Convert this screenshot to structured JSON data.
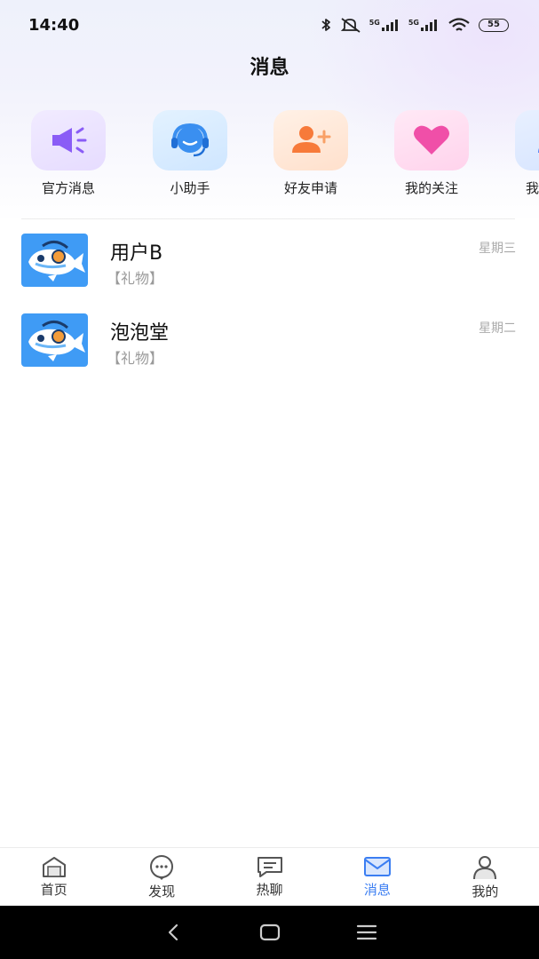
{
  "status_bar": {
    "time": "14:40",
    "network_1": "5G",
    "network_2": "5G",
    "battery": "55"
  },
  "header": {
    "title": "消息"
  },
  "quick_entries": [
    {
      "label": "官方消息",
      "icon": "megaphone-icon",
      "color": "#8a5cf6"
    },
    {
      "label": "小助手",
      "icon": "headset-icon",
      "color": "#3a8ff0"
    },
    {
      "label": "好友申请",
      "icon": "add-friend-icon",
      "color": "#f77a3a"
    },
    {
      "label": "我的关注",
      "icon": "heart-icon",
      "color": "#f04fa8"
    },
    {
      "label": "我的粉丝",
      "icon": "user-icon",
      "color": "#4b7cf5"
    }
  ],
  "conversations": [
    {
      "name": "用户B",
      "preview": "【礼物】",
      "time": "星期三"
    },
    {
      "name": "泡泡堂",
      "preview": "【礼物】",
      "time": "星期二"
    }
  ],
  "tab_bar": {
    "tabs": [
      {
        "label": "首页",
        "icon": "home-icon"
      },
      {
        "label": "发现",
        "icon": "discover-icon"
      },
      {
        "label": "热聊",
        "icon": "hot-chat-icon"
      },
      {
        "label": "消息",
        "icon": "mail-icon",
        "active": true
      },
      {
        "label": "我的",
        "icon": "profile-icon"
      }
    ],
    "active_color": "#3b7ef2"
  },
  "system_nav": {
    "buttons": [
      "back-icon",
      "home-button-icon",
      "menu-icon"
    ]
  }
}
